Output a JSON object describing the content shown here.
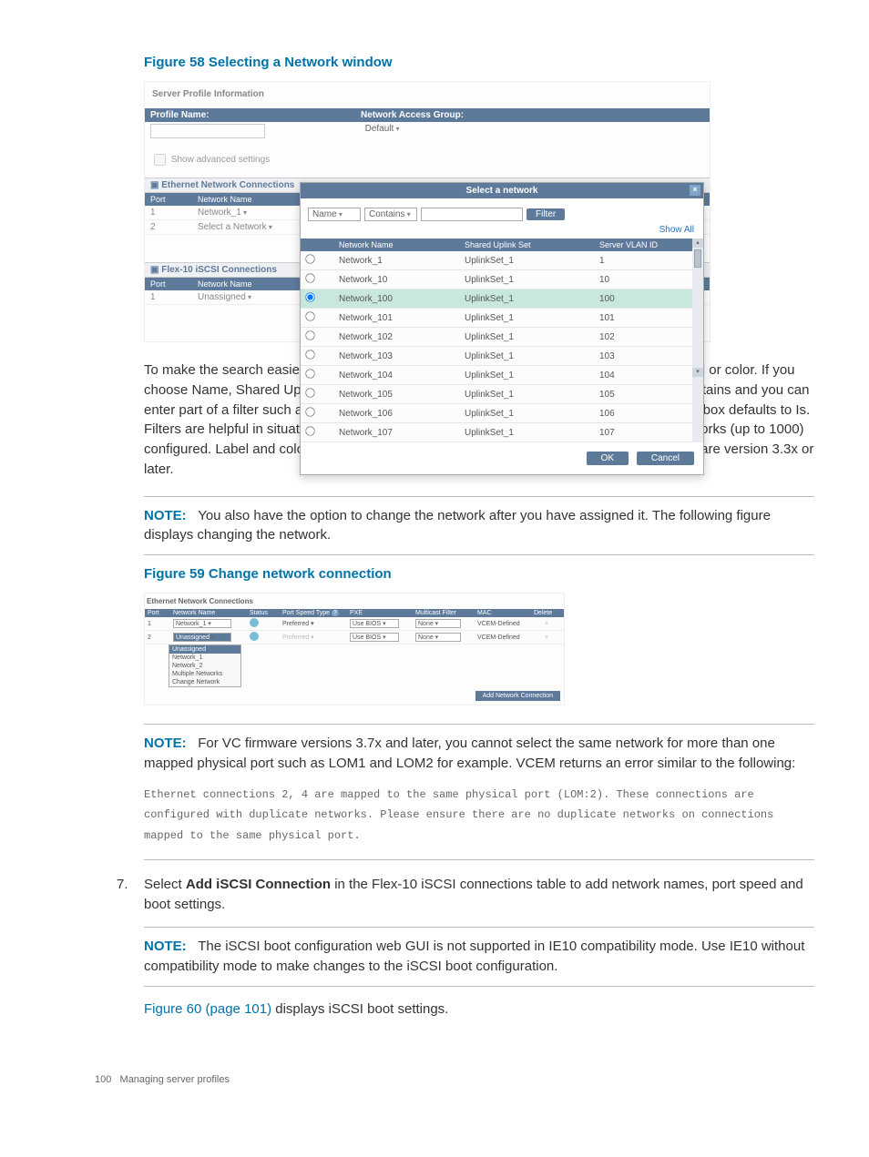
{
  "figure58": "Figure 58 Selecting a Network window",
  "ss1": {
    "title": "Server Profile Information",
    "blue_left": "Profile Name:",
    "blue_right": "Network Access Group:",
    "default_dd": "Default",
    "show_adv": "Show advanced settings",
    "eth_header": "Ethernet Network Connections",
    "col_port": "Port",
    "col_name": "Network Name",
    "rows": [
      {
        "port": "1",
        "name": "Network_1"
      },
      {
        "port": "2",
        "name": "Select a Network"
      }
    ],
    "flex_header": "Flex-10 iSCSI Connections",
    "flex_rows": [
      {
        "port": "1",
        "name": "Unassigned"
      }
    ]
  },
  "popup": {
    "title": "Select a network",
    "filter_by": "Name",
    "filter_op": "Contains",
    "filter_btn": "Filter",
    "show_all": "Show All",
    "cols": {
      "name": "Network Name",
      "sus": "Shared Uplink Set",
      "vlan": "Server VLAN ID"
    },
    "rows": [
      {
        "name": "Network_1",
        "sus": "UplinkSet_1",
        "vlan": "1"
      },
      {
        "name": "Network_10",
        "sus": "UplinkSet_1",
        "vlan": "10"
      },
      {
        "name": "Network_100",
        "sus": "UplinkSet_1",
        "vlan": "100",
        "selected": true
      },
      {
        "name": "Network_101",
        "sus": "UplinkSet_1",
        "vlan": "101"
      },
      {
        "name": "Network_102",
        "sus": "UplinkSet_1",
        "vlan": "102"
      },
      {
        "name": "Network_103",
        "sus": "UplinkSet_1",
        "vlan": "103"
      },
      {
        "name": "Network_104",
        "sus": "UplinkSet_1",
        "vlan": "104"
      },
      {
        "name": "Network_105",
        "sus": "UplinkSet_1",
        "vlan": "105"
      },
      {
        "name": "Network_106",
        "sus": "UplinkSet_1",
        "vlan": "106"
      },
      {
        "name": "Network_107",
        "sus": "UplinkSet_1",
        "vlan": "107"
      }
    ],
    "ok": "OK",
    "cancel": "Cancel"
  },
  "para1": "To make the search easier, you can apply filters by Name, Shared Uplink Set, VLAN ID, label or color. If you choose Name, Shared Uplink Set, VLAN or label, the second drop-down box defaults to Contains and you can enter part of a filter such as Name or Shared Uplink Set. If you choose Color, the drop-down box defaults to Is. Filters are helpful in situations where a VC Domain Group has a large amount of VLAN networks (up to 1000) configured. Label and color filters are only available in VC Domain Groups running VC firmware version 3.3x or later.",
  "note1_label": "NOTE:",
  "note1": "You also have the option to change the network after you have assigned it. The following figure displays changing the network.",
  "figure59": "Figure 59 Change network connection",
  "ss2": {
    "title": "Ethernet Network Connections",
    "cols": {
      "port": "Port",
      "net": "Network Name",
      "stat": "Status",
      "pst": "Port Speed Type",
      "pst_icon": "?",
      "pxe": "PXE",
      "mcast": "Multicast Filter",
      "mac": "MAC",
      "del": "Delete"
    },
    "rows": [
      {
        "port": "1",
        "net": "Network_1",
        "pst": "Preferred",
        "pxe": "Use BIOS",
        "mcast": "None",
        "mac": "VCEM-Defined"
      },
      {
        "port": "2",
        "net": "Unassigned",
        "pst": "Preferred",
        "pxe": "Use BIOS",
        "mcast": "None",
        "mac": "VCEM-Defined"
      }
    ],
    "dropdown": [
      "Unassigned",
      "Network_1",
      "Network_2",
      "Multiple Networks",
      "Change Network"
    ],
    "add_btn": "Add Network Connection"
  },
  "note2_label": "NOTE:",
  "note2": "For VC firmware versions 3.7x and later, you cannot select the same network for more than one mapped physical port such as LOM1 and LOM2 for example. VCEM returns an error similar to the following:",
  "mono": "Ethernet connections 2, 4 are mapped to the same physical port (LOM:2). These connections are configured with duplicate networks. Please ensure there are no duplicate networks on connections mapped to the same physical port.",
  "step7_num": "7.",
  "step7_a": "Select ",
  "step7_bold": "Add iSCSI Connection",
  "step7_b": " in the Flex-10 iSCSI connections table to add network names, port speed and boot settings.",
  "note3_label": "NOTE:",
  "note3": "The iSCSI boot configuration web GUI is not supported in IE10 compatibility mode. Use IE10 without compatibility mode to make changes to the iSCSI boot configuration.",
  "fig60_link": "Figure 60 (page 101)",
  "fig60_tail": " displays iSCSI boot settings.",
  "footer_page": "100",
  "footer_text": "Managing server profiles"
}
